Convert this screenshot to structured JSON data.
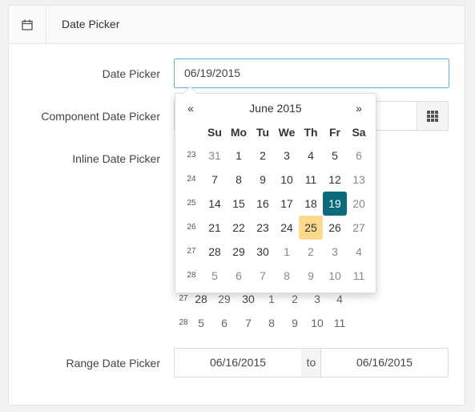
{
  "header": {
    "title": "Date Picker",
    "icon": "calendar-icon"
  },
  "fields": {
    "date_picker": {
      "label": "Date Picker",
      "value": "06/19/2015"
    },
    "component_date_picker": {
      "label": "Component Date Picker",
      "value": "",
      "button_icon": "grid-icon"
    },
    "inline_date_picker": {
      "label": "Inline Date Picker"
    },
    "range_date_picker": {
      "label": "Range Date Picker",
      "start": "06/16/2015",
      "separator": "to",
      "end": "06/16/2015"
    }
  },
  "inline_visible_rows": [
    {
      "week": "27",
      "days": [
        "28",
        "29",
        "30",
        "1",
        "2",
        "3",
        "4"
      ]
    },
    {
      "week": "28",
      "days": [
        "5",
        "6",
        "7",
        "8",
        "9",
        "10",
        "11"
      ]
    }
  ],
  "popup": {
    "month_label": "June 2015",
    "prev": "«",
    "next": "»",
    "weekdays": [
      "Su",
      "Mo",
      "Tu",
      "We",
      "Th",
      "Fr",
      "Sa"
    ],
    "weeks": [
      {
        "week": "23",
        "days": [
          {
            "d": "31",
            "m": true
          },
          {
            "d": "1"
          },
          {
            "d": "2"
          },
          {
            "d": "3"
          },
          {
            "d": "4"
          },
          {
            "d": "5"
          },
          {
            "d": "6",
            "m": true
          }
        ]
      },
      {
        "week": "24",
        "days": [
          {
            "d": "7"
          },
          {
            "d": "8"
          },
          {
            "d": "9"
          },
          {
            "d": "10"
          },
          {
            "d": "11"
          },
          {
            "d": "12"
          },
          {
            "d": "13",
            "m": true
          }
        ]
      },
      {
        "week": "25",
        "days": [
          {
            "d": "14"
          },
          {
            "d": "15"
          },
          {
            "d": "16"
          },
          {
            "d": "17"
          },
          {
            "d": "18"
          },
          {
            "d": "19",
            "sel": true
          },
          {
            "d": "20",
            "m": true
          }
        ]
      },
      {
        "week": "26",
        "days": [
          {
            "d": "21"
          },
          {
            "d": "22"
          },
          {
            "d": "23"
          },
          {
            "d": "24"
          },
          {
            "d": "25",
            "today": true
          },
          {
            "d": "26"
          },
          {
            "d": "27",
            "m": true
          }
        ]
      },
      {
        "week": "27",
        "days": [
          {
            "d": "28"
          },
          {
            "d": "29"
          },
          {
            "d": "30"
          },
          {
            "d": "1",
            "m": true
          },
          {
            "d": "2",
            "m": true
          },
          {
            "d": "3",
            "m": true
          },
          {
            "d": "4",
            "m": true
          }
        ]
      },
      {
        "week": "28",
        "days": [
          {
            "d": "5",
            "m": true
          },
          {
            "d": "6",
            "m": true
          },
          {
            "d": "7",
            "m": true
          },
          {
            "d": "8",
            "m": true
          },
          {
            "d": "9",
            "m": true
          },
          {
            "d": "10",
            "m": true
          },
          {
            "d": "11",
            "m": true
          }
        ]
      }
    ]
  },
  "colors": {
    "selected": "#0c6b7a",
    "today": "#fcd98c",
    "focus_border": "#66afe9"
  }
}
